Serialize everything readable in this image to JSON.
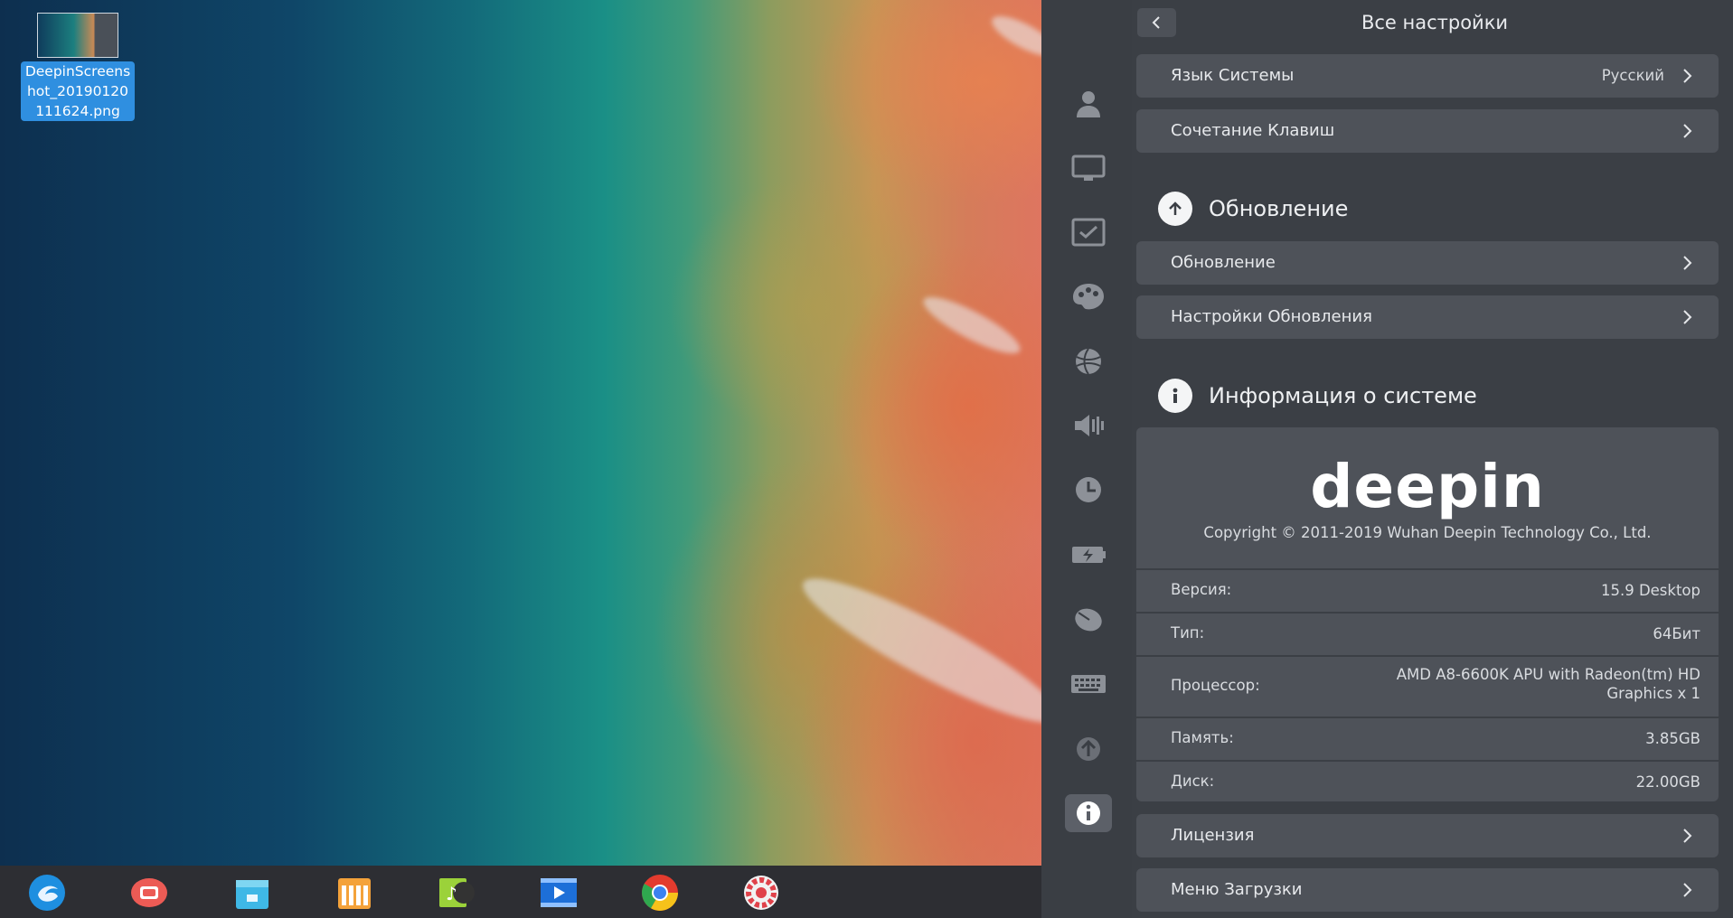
{
  "desktop": {
    "file_icon_label": "DeepinScreens\nhot_20190120\n111624.png"
  },
  "dock": {
    "items": [
      {
        "icon": "launcher-icon"
      },
      {
        "icon": "screen-recorder-icon"
      },
      {
        "icon": "app-store-icon"
      },
      {
        "icon": "file-manager-icon"
      },
      {
        "icon": "music-icon"
      },
      {
        "icon": "movie-icon"
      },
      {
        "icon": "chrome-icon"
      },
      {
        "icon": "settings-icon"
      }
    ]
  },
  "settings": {
    "header_title": "Все настройки",
    "rows_top": [
      {
        "label": "Язык Системы",
        "value": "Русский"
      },
      {
        "label": "Сочетание Клавиш",
        "value": ""
      }
    ],
    "update_section": {
      "title": "Обновление",
      "rows": [
        {
          "label": "Обновление"
        },
        {
          "label": "Настройки Обновления"
        }
      ]
    },
    "system_info": {
      "title": "Информация о системе",
      "logo_text": "deepin",
      "copyright": "Copyright © 2011-2019 Wuhan Deepin Technology Co., Ltd.",
      "items": [
        {
          "key": "Версия:",
          "value": "15.9 Desktop"
        },
        {
          "key": "Тип:",
          "value": "64Бит"
        },
        {
          "key": "Процессор:",
          "value": "AMD A8-6600K APU with Radeon(tm) HD\nGraphics x 1"
        },
        {
          "key": "Память:",
          "value": "3.85GB"
        },
        {
          "key": "Диск:",
          "value": "22.00GB"
        }
      ]
    },
    "rows_bottom": [
      {
        "label": "Лицензия"
      },
      {
        "label": "Меню Загрузки"
      }
    ],
    "sidebar_icons": [
      "accounts-icon",
      "display-icon",
      "default-apps-icon",
      "personalization-icon",
      "network-icon",
      "sound-icon",
      "datetime-icon",
      "power-icon",
      "mouse-icon",
      "keyboard-icon",
      "update-icon",
      "system-info-icon"
    ]
  }
}
